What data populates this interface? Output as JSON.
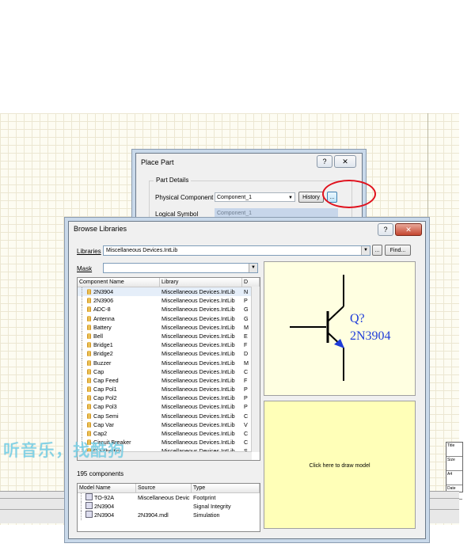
{
  "place_part": {
    "title": "Place Part",
    "help_btn": "?",
    "close_btn": "✕",
    "group_title": "Part Details",
    "physical_label": "Physical Component",
    "physical_value": "Component_1",
    "history_btn": "History",
    "browse_btn": "...",
    "logical_label": "Logical Symbol",
    "logical_value": "Component_1"
  },
  "browse": {
    "title": "Browse Libraries",
    "help_btn": "?",
    "close_btn": "✕",
    "libraries_label": "Libraries",
    "libraries_value": "Miscellaneous Devices.IntLib",
    "more_btn": "...",
    "find_btn": "Find...",
    "mask_label": "Mask",
    "mask_value": "",
    "columns": [
      "Component Name",
      "Library",
      "D"
    ],
    "components": [
      {
        "name": "2N3904",
        "lib": "Miscellaneous Devices.IntLib",
        "d": "N"
      },
      {
        "name": "2N3906",
        "lib": "Miscellaneous Devices.IntLib",
        "d": "P"
      },
      {
        "name": "ADC-8",
        "lib": "Miscellaneous Devices.IntLib",
        "d": "G"
      },
      {
        "name": "Antenna",
        "lib": "Miscellaneous Devices.IntLib",
        "d": "G"
      },
      {
        "name": "Battery",
        "lib": "Miscellaneous Devices.IntLib",
        "d": "M"
      },
      {
        "name": "Bell",
        "lib": "Miscellaneous Devices.IntLib",
        "d": "E"
      },
      {
        "name": "Bridge1",
        "lib": "Miscellaneous Devices.IntLib",
        "d": "F"
      },
      {
        "name": "Bridge2",
        "lib": "Miscellaneous Devices.IntLib",
        "d": "D"
      },
      {
        "name": "Buzzer",
        "lib": "Miscellaneous Devices.IntLib",
        "d": "M"
      },
      {
        "name": "Cap",
        "lib": "Miscellaneous Devices.IntLib",
        "d": "C"
      },
      {
        "name": "Cap Feed",
        "lib": "Miscellaneous Devices.IntLib",
        "d": "F"
      },
      {
        "name": "Cap Pol1",
        "lib": "Miscellaneous Devices.IntLib",
        "d": "P"
      },
      {
        "name": "Cap Pol2",
        "lib": "Miscellaneous Devices.IntLib",
        "d": "P"
      },
      {
        "name": "Cap Pol3",
        "lib": "Miscellaneous Devices.IntLib",
        "d": "P"
      },
      {
        "name": "Cap Semi",
        "lib": "Miscellaneous Devices.IntLib",
        "d": "C"
      },
      {
        "name": "Cap Var",
        "lib": "Miscellaneous Devices.IntLib",
        "d": "V"
      },
      {
        "name": "Cap2",
        "lib": "Miscellaneous Devices.IntLib",
        "d": "C"
      },
      {
        "name": "Circuit Breaker",
        "lib": "Miscellaneous Devices.IntLib",
        "d": "C"
      },
      {
        "name": "D Schottky",
        "lib": "Miscellaneous Devices.IntLib",
        "d": "S"
      }
    ],
    "count": "195 components",
    "designator": "Q?",
    "part_name": "2N3904",
    "draw_model": "Click here to draw model",
    "model_columns": [
      "Model Name",
      "Source",
      "Type"
    ],
    "models": [
      {
        "name": "TO-92A",
        "source": "Miscellaneous Devic",
        "type": "Footprint"
      },
      {
        "name": "2N3904",
        "source": "",
        "type": "Signal Integrity"
      },
      {
        "name": "2N3904",
        "source": "2N3904.mdl",
        "type": "Simulation"
      }
    ]
  },
  "watermark": "听音乐，找酷狗",
  "titleblock": [
    "Title",
    "Size",
    "A4",
    "Date"
  ]
}
